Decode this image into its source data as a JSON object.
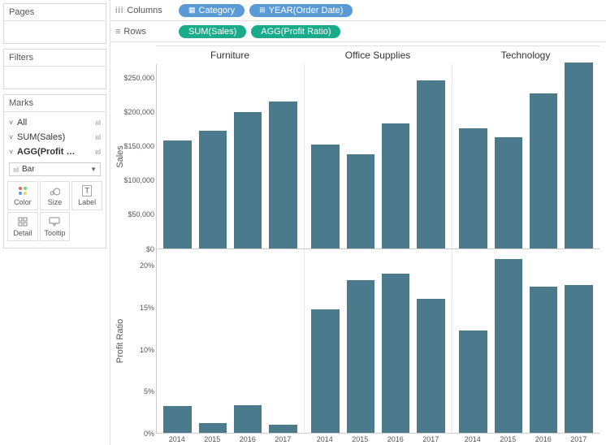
{
  "sidebar": {
    "pages_title": "Pages",
    "filters_title": "Filters",
    "marks_title": "Marks",
    "marks_items": [
      {
        "caret": "˅",
        "label": "All"
      },
      {
        "caret": "˅",
        "label": "SUM(Sales)"
      },
      {
        "caret": "˅",
        "label": "AGG(Profit …"
      }
    ],
    "mark_type_label": "Bar",
    "cards": {
      "color": "Color",
      "size": "Size",
      "label": "Label",
      "detail": "Detail",
      "tooltip": "Tooltip"
    }
  },
  "shelves": {
    "columns_label": "Columns",
    "rows_label": "Rows",
    "columns_pills": [
      "Category",
      "YEAR(Order Date)"
    ],
    "rows_pills": [
      "SUM(Sales)",
      "AGG(Profit Ratio)"
    ]
  },
  "chart_data": [
    {
      "type": "bar",
      "ylabel": "Sales",
      "ylim": [
        0,
        270000
      ],
      "y_ticks": [
        "$0",
        "$50,000",
        "$100,000",
        "$150,000",
        "$200,000",
        "$250,000"
      ],
      "panels": [
        "Furniture",
        "Office Supplies",
        "Technology"
      ],
      "x": [
        "2014",
        "2015",
        "2016",
        "2017"
      ],
      "series": [
        {
          "panel": "Furniture",
          "values": [
            158000,
            172000,
            200000,
            215000
          ]
        },
        {
          "panel": "Office Supplies",
          "values": [
            152000,
            138000,
            183000,
            246000
          ]
        },
        {
          "panel": "Technology",
          "values": [
            176000,
            163000,
            227000,
            272000
          ]
        }
      ]
    },
    {
      "type": "bar",
      "ylabel": "Profit Ratio",
      "ylim": [
        0,
        22
      ],
      "y_ticks": [
        "0%",
        "5%",
        "10%",
        "15%",
        "20%"
      ],
      "panels": [
        "Furniture",
        "Office Supplies",
        "Technology"
      ],
      "x": [
        "2014",
        "2015",
        "2016",
        "2017"
      ],
      "series": [
        {
          "panel": "Furniture",
          "values": [
            3.2,
            1.2,
            3.3,
            1.0
          ]
        },
        {
          "panel": "Office Supplies",
          "values": [
            14.8,
            18.3,
            19.0,
            16.0
          ]
        },
        {
          "panel": "Technology",
          "values": [
            12.2,
            20.8,
            17.5,
            17.7
          ]
        }
      ]
    }
  ]
}
